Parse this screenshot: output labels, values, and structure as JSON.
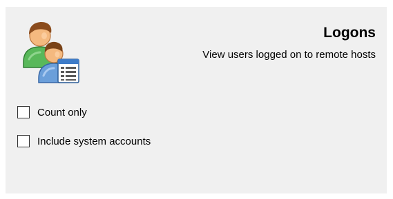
{
  "header": {
    "icon": "users-logon-icon",
    "title": "Logons",
    "subtitle": "View users logged on to remote hosts"
  },
  "options": [
    {
      "label": "Count only",
      "checked": false
    },
    {
      "label": "Include system accounts",
      "checked": false
    }
  ],
  "colors": {
    "panel_background": "#f0f0f0",
    "page_background": "#ffffff",
    "user_green": "#5cb85c",
    "user_blue": "#6a9fd8",
    "hair_brown": "#8a4a1c",
    "skin": "#f2b77e"
  }
}
